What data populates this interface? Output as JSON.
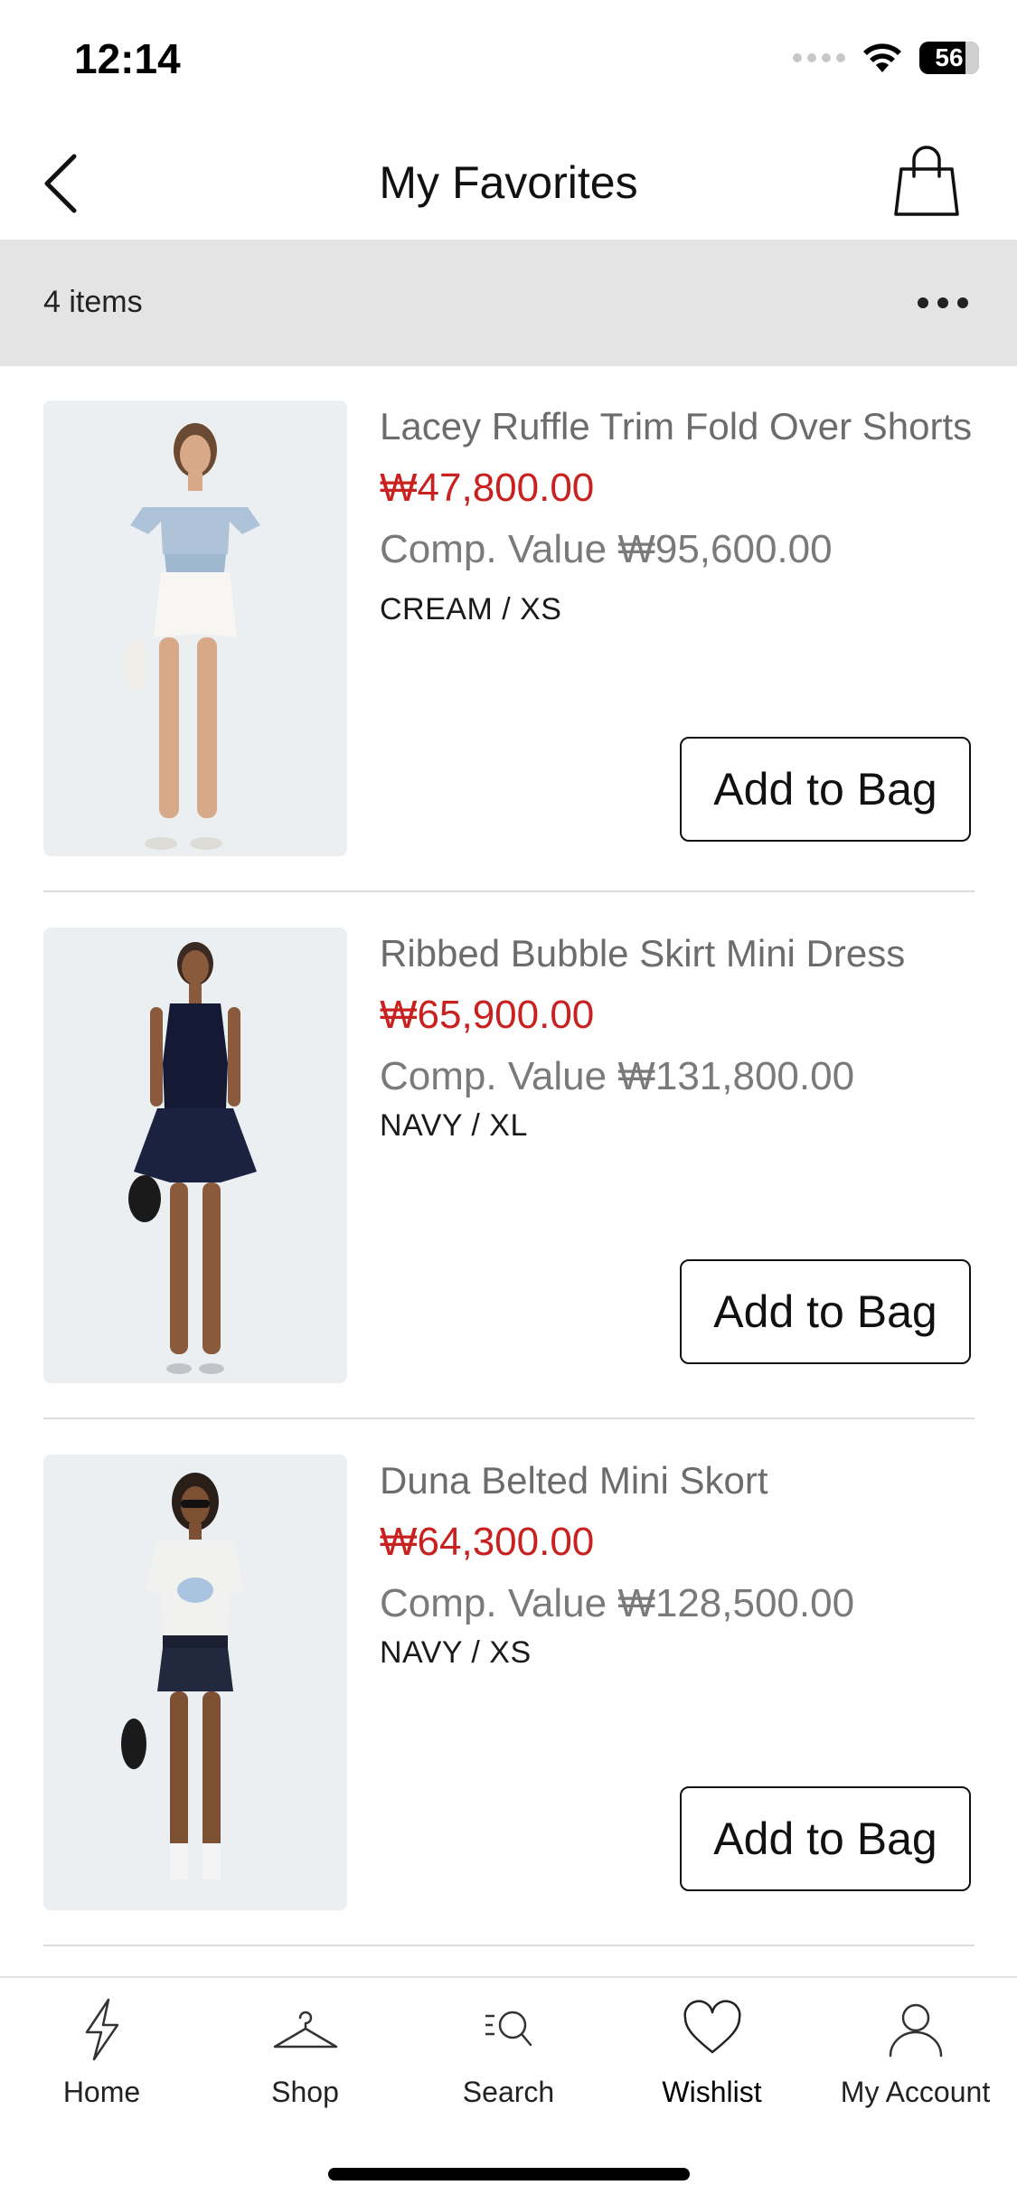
{
  "status_bar": {
    "time": "12:14",
    "battery": "56"
  },
  "header": {
    "title": "My Favorites"
  },
  "list_header": {
    "count_text": "4 items"
  },
  "items": [
    {
      "name": "Lacey Ruffle Trim Fold Over Shorts",
      "price": "₩47,800.00",
      "comp_value": "Comp. Value ₩95,600.00",
      "variant": "CREAM / XS",
      "button_label": "Add to Bag"
    },
    {
      "name": "Ribbed Bubble Skirt Mini Dress",
      "price": "₩65,900.00",
      "comp_value": "Comp. Value ₩131,800.00",
      "variant": "NAVY / XL",
      "button_label": "Add to Bag"
    },
    {
      "name": "Duna Belted Mini Skort",
      "price": "₩64,300.00",
      "comp_value": "Comp. Value ₩128,500.00",
      "variant": "NAVY / XS",
      "button_label": "Add to Bag"
    }
  ],
  "tabbar": {
    "home": "Home",
    "shop": "Shop",
    "search": "Search",
    "wishlist": "Wishlist",
    "account": "My Account"
  },
  "colors": {
    "price": "#c8211f",
    "count_bar": "#e4e4e4",
    "image_bg": "#eceff2"
  },
  "icons": [
    "back-arrow-icon",
    "shopping-bag-icon",
    "more-icon",
    "lightning-icon",
    "hanger-icon",
    "search-list-icon",
    "heart-icon",
    "user-icon"
  ]
}
